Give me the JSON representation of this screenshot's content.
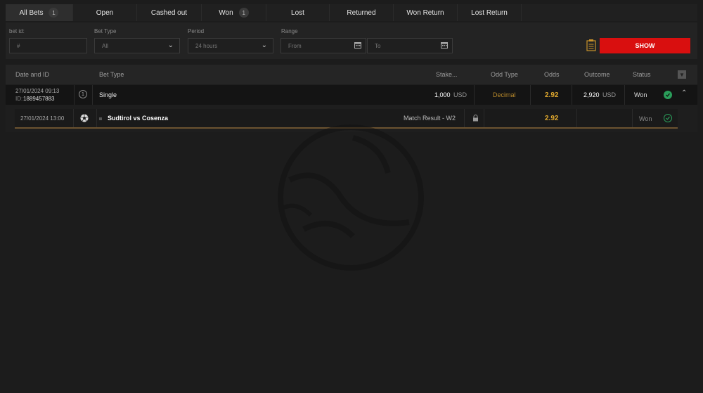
{
  "tabs": [
    {
      "label": "All Bets",
      "count": "1",
      "active": true
    },
    {
      "label": "Open",
      "count": ""
    },
    {
      "label": "Cashed out",
      "count": ""
    },
    {
      "label": "Won",
      "count": "1"
    },
    {
      "label": "Lost",
      "count": ""
    },
    {
      "label": "Returned",
      "count": ""
    },
    {
      "label": "Won Return",
      "count": ""
    },
    {
      "label": "Lost Return",
      "count": ""
    }
  ],
  "filters": {
    "bet_id_label": "bet id:",
    "bet_id_placeholder": "#",
    "bet_type_label": "Bet Type",
    "bet_type_value": "All",
    "period_label": "Period",
    "period_value": "24 hours",
    "range_label": "Range",
    "range_from": "From",
    "range_to": "To",
    "show_label": "SHOW"
  },
  "table": {
    "headers": {
      "date_id": "Date and ID",
      "bet_type": "Bet Type",
      "stake": "Stake...",
      "odd_type": "Odd Type",
      "odds": "Odds",
      "outcome": "Outcome",
      "status": "Status"
    },
    "bet": {
      "date": "27/01/2024 09:13",
      "id_label": "ID:",
      "id": "1889457883",
      "num": "1",
      "type": "Single",
      "stake": "1,000",
      "stake_currency": "USD",
      "odd_type": "Decimal",
      "odds": "2.92",
      "outcome": "2,920",
      "outcome_currency": "USD",
      "status": "Won"
    },
    "selection": {
      "date": "27/01/2024 13:00",
      "match": "Sudtirol vs Cosenza",
      "market": "Match Result - W2",
      "odds": "2.92",
      "status": "Won"
    }
  },
  "colors": {
    "accent_red": "#d90f0f",
    "odds_gold": "#e0a82e",
    "odd_type_gold": "#b8892b",
    "won_green": "#2a9d5a"
  }
}
